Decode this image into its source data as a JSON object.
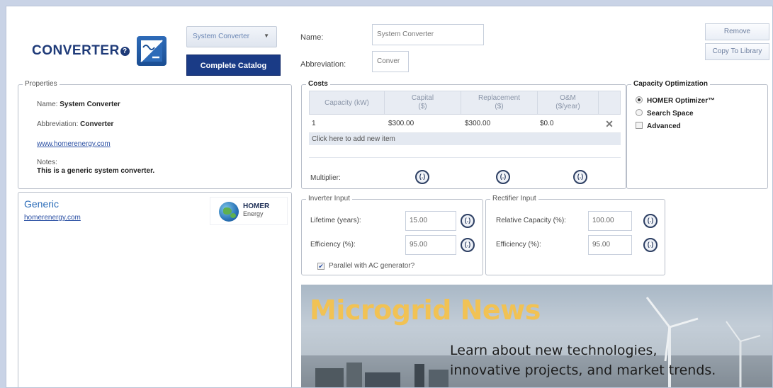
{
  "header": {
    "logo_text": "CONVERTER",
    "help_badge": "?",
    "dropdown_value": "System Converter",
    "catalog_button": "Complete Catalog",
    "name_label": "Name:",
    "name_value": "System Converter",
    "abbrev_label": "Abbreviation:",
    "abbrev_value": "Conver",
    "remove_button": "Remove",
    "copy_button": "Copy To Library"
  },
  "properties": {
    "title": "Properties",
    "name_label": "Name:",
    "name_value": "System Converter",
    "abbrev_label": "Abbreviation:",
    "abbrev_value": "Converter",
    "link": "www.homerenergy.com",
    "notes_label": "Notes:",
    "notes_value": "This is a generic system converter."
  },
  "costs": {
    "title": "Costs",
    "headers": {
      "capacity": "Capacity (kW)",
      "capital_1": "Capital",
      "capital_2": "($)",
      "replacement_1": "Replacement",
      "replacement_2": "($)",
      "om_1": "O&M",
      "om_2": "($/year)"
    },
    "rows": [
      {
        "capacity": "1",
        "capital": "$300.00",
        "replacement": "$300.00",
        "om": "$0.0"
      }
    ],
    "add_row": "Click here to add new item",
    "multiplier_label": "Multiplier:",
    "sens_symbol": "(.)"
  },
  "capacity_optimization": {
    "title": "Capacity Optimization",
    "option_homer": "HOMER Optimizer™",
    "option_search": "Search Space",
    "advanced": "Advanced"
  },
  "generic": {
    "title": "Generic",
    "link": "homerenergy.com",
    "logo_text": "HOMER",
    "logo_sub": "Energy"
  },
  "inverter": {
    "title": "Inverter Input",
    "lifetime_label": "Lifetime (years):",
    "lifetime_value": "15.00",
    "efficiency_label": "Efficiency (%):",
    "efficiency_value": "95.00",
    "parallel_label": "Parallel with AC generator?"
  },
  "rectifier": {
    "title": "Rectifier Input",
    "capacity_label": "Relative Capacity (%):",
    "capacity_value": "100.00",
    "efficiency_label": "Efficiency (%):",
    "efficiency_value": "95.00"
  },
  "banner": {
    "title": "Microgrid News",
    "line1": "Learn about new technologies,",
    "line2": "innovative projects, and market trends."
  },
  "colors": {
    "accent": "#1a3b86",
    "link": "#2a4fa3",
    "banner_title": "#f1c254"
  }
}
